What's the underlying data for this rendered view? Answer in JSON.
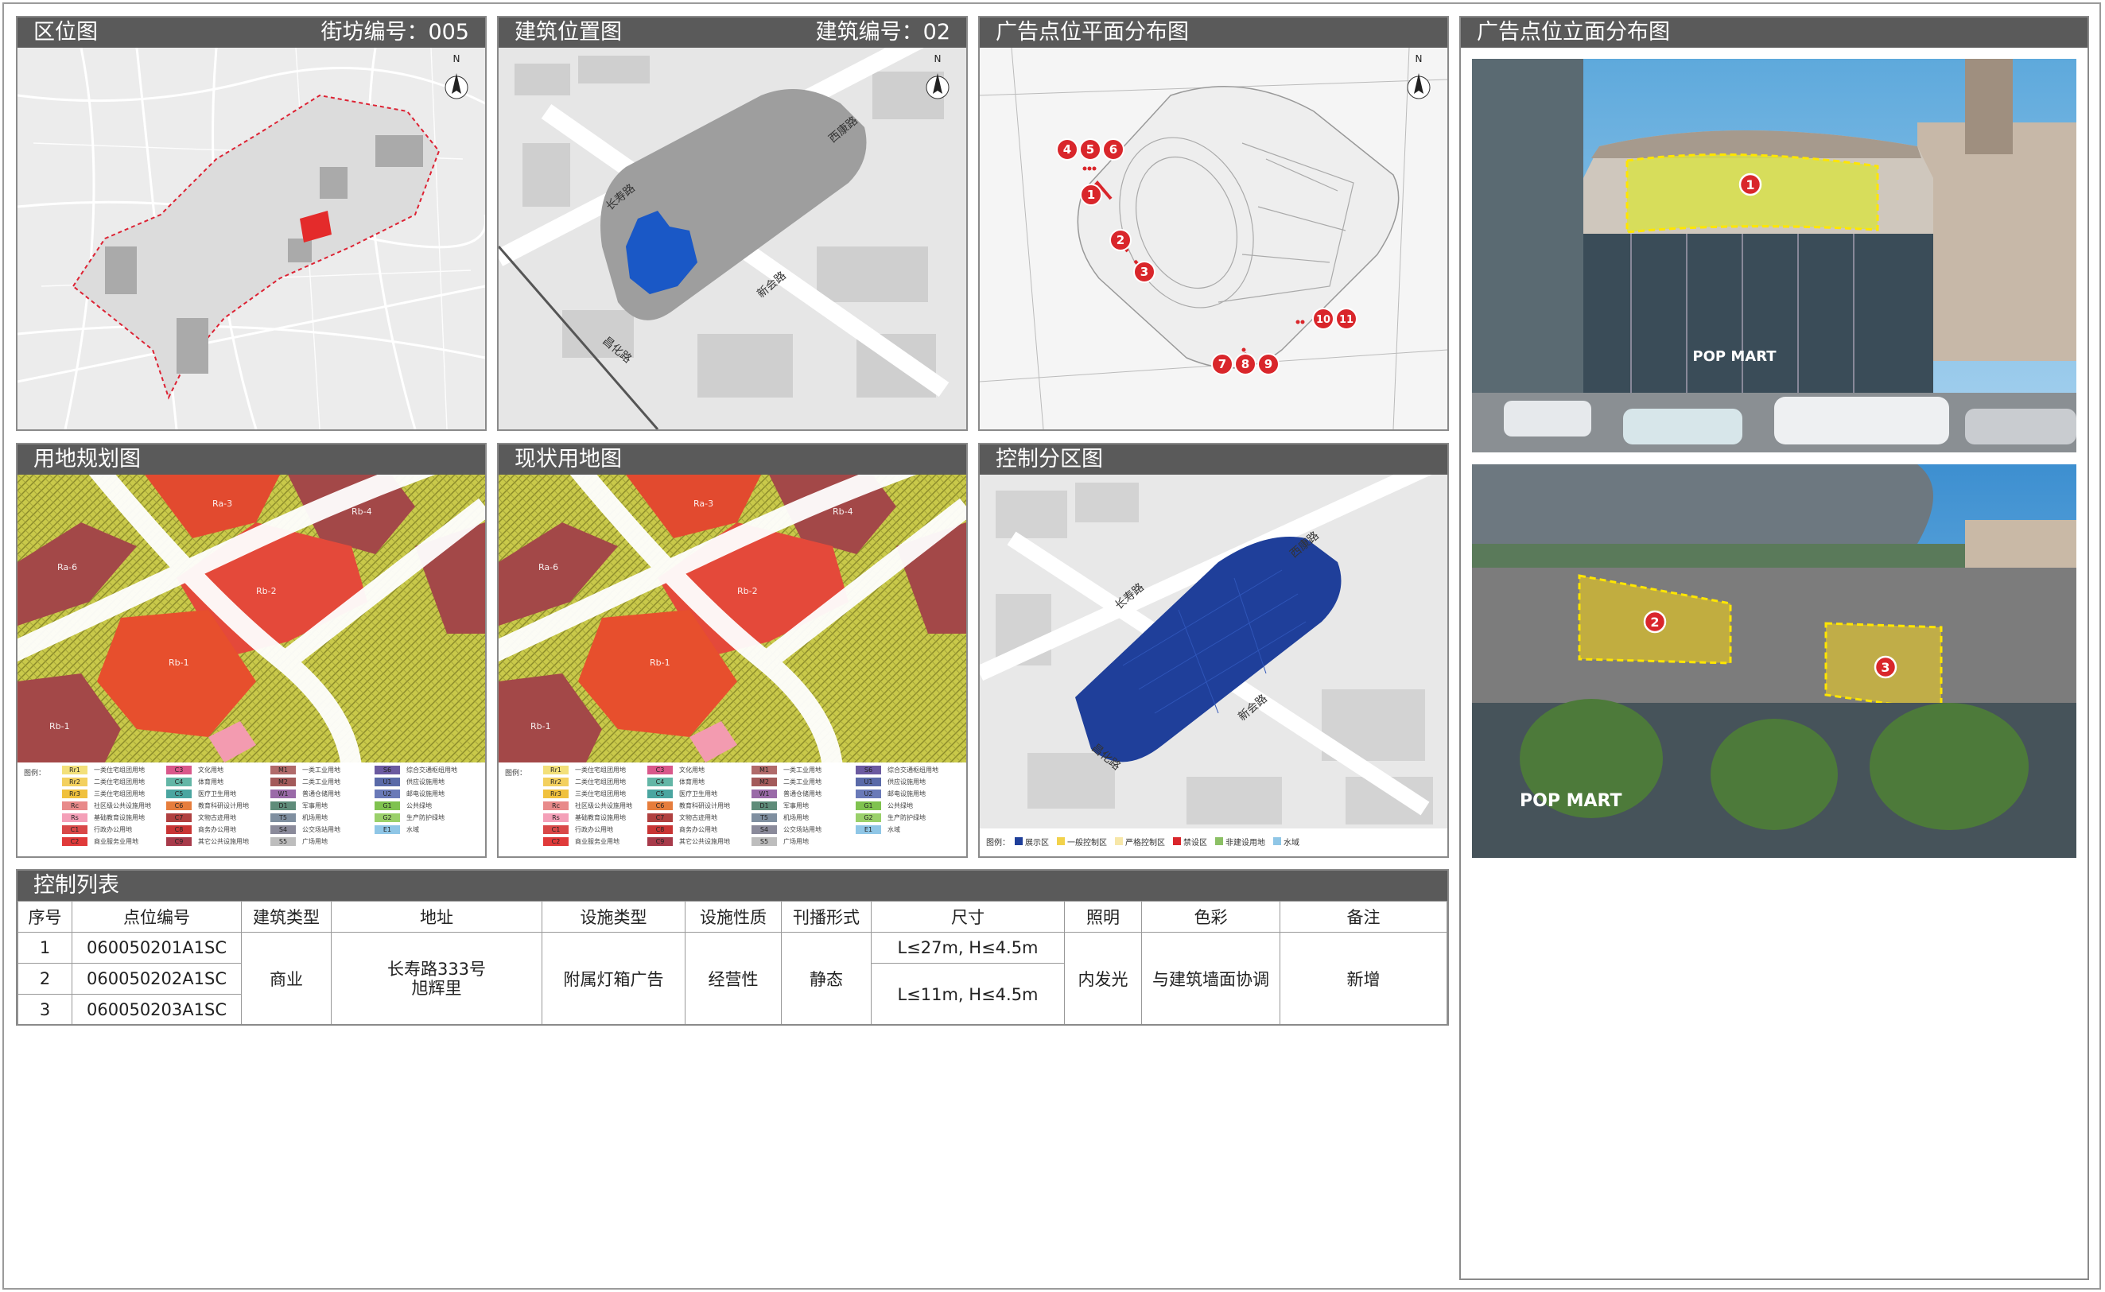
{
  "panels": {
    "location": {
      "title": "区位图",
      "sub": "街坊编号：005"
    },
    "building": {
      "title": "建筑位置图",
      "sub": "建筑编号：02",
      "roads": [
        "长寿路",
        "新会路",
        "昌化路",
        "西康路"
      ]
    },
    "plan": {
      "title": "广告点位平面分布图",
      "markers": [
        "1",
        "2",
        "3",
        "4",
        "5",
        "6",
        "7",
        "8",
        "9",
        "10",
        "11"
      ]
    },
    "elevation": {
      "title": "广告点位立面分布图",
      "markers": [
        "1",
        "2",
        "3"
      ],
      "sign_text": "POP MART"
    },
    "landuse_plan": {
      "title": "用地规划图",
      "legend_prefix": "图例："
    },
    "landuse_now": {
      "title": "现状用地图",
      "legend_prefix": "图例："
    },
    "control": {
      "title": "控制分区图",
      "roads": [
        "长寿路",
        "新会路",
        "昌化路",
        "西康路"
      ],
      "legend_prefix": "图例：",
      "legend": [
        {
          "label": "展示区",
          "color": "#1f3f9a"
        },
        {
          "label": "一般控制区",
          "color": "#f2d24b"
        },
        {
          "label": "严格控制区",
          "color": "#f7e7a8"
        },
        {
          "label": "禁设区",
          "color": "#d9262b"
        },
        {
          "label": "非建设用地",
          "color": "#8cc065"
        },
        {
          "label": "水域",
          "color": "#8fc6e6"
        }
      ]
    }
  },
  "north": "N",
  "legend_items": [
    {
      "code": "Rr1",
      "name": "一类住宅组团用地",
      "color": "#f3e07a"
    },
    {
      "code": "Rr2",
      "name": "二类住宅组团用地",
      "color": "#f3d05e"
    },
    {
      "code": "Rr3",
      "name": "三类住宅组团用地",
      "color": "#f0c13e"
    },
    {
      "code": "Rc",
      "name": "社区级公共设施用地",
      "color": "#e88a8a"
    },
    {
      "code": "Rs",
      "name": "基础教育设施用地",
      "color": "#f4a0b8"
    },
    {
      "code": "C1",
      "name": "行政办公用地",
      "color": "#d94848"
    },
    {
      "code": "C2",
      "name": "商业服务业用地",
      "color": "#e03a3a"
    },
    {
      "code": "C3",
      "name": "文化用地",
      "color": "#d9588a"
    },
    {
      "code": "C4",
      "name": "体育用地",
      "color": "#63b6a6"
    },
    {
      "code": "C5",
      "name": "医疗卫生用地",
      "color": "#4aa5a0"
    },
    {
      "code": "C6",
      "name": "教育科研设计用地",
      "color": "#e67d3c"
    },
    {
      "code": "C7",
      "name": "文物古迹用地",
      "color": "#b04040"
    },
    {
      "code": "C8",
      "name": "商务办公用地",
      "color": "#c83434"
    },
    {
      "code": "C9",
      "name": "其它公共设施用地",
      "color": "#a73a4a"
    },
    {
      "code": "M1",
      "name": "一类工业用地",
      "color": "#b06a6a"
    },
    {
      "code": "M2",
      "name": "二类工业用地",
      "color": "#a35a5a"
    },
    {
      "code": "W1",
      "name": "普通仓储用地",
      "color": "#9a6aa8"
    },
    {
      "code": "D1",
      "name": "军事用地",
      "color": "#5f8c7a"
    },
    {
      "code": "T5",
      "name": "机场用地",
      "color": "#7f8fa0"
    },
    {
      "code": "S4",
      "name": "公交场站用地",
      "color": "#8a8a9a"
    },
    {
      "code": "S5",
      "name": "广场用地",
      "color": "#bdbdbd"
    },
    {
      "code": "S6",
      "name": "综合交通枢纽用地",
      "color": "#6b5aa0"
    },
    {
      "code": "U1",
      "name": "供应设施用地",
      "color": "#5a6aa8"
    },
    {
      "code": "U2",
      "name": "邮电设施用地",
      "color": "#6a7ab8"
    },
    {
      "code": "G1",
      "name": "公共绿地",
      "color": "#7fc24f"
    },
    {
      "code": "G2",
      "name": "生产防护绿地",
      "color": "#9ad06a"
    },
    {
      "code": "E1",
      "name": "水域",
      "color": "#8fc6e6"
    }
  ],
  "table": {
    "title": "控制列表",
    "headers": [
      "序号",
      "点位编号",
      "建筑类型",
      "地址",
      "设施类型",
      "设施性质",
      "刊播形式",
      "尺寸",
      "照明",
      "色彩",
      "备注"
    ],
    "rows": [
      {
        "no": "1",
        "code": "060050201A1SC"
      },
      {
        "no": "2",
        "code": "060050202A1SC"
      },
      {
        "no": "3",
        "code": "060050203A1SC"
      }
    ],
    "building_type": "商业",
    "address_line1": "长寿路333号",
    "address_line2": "旭辉里",
    "facility_type": "附属灯箱广告",
    "facility_nature": "经营性",
    "broadcast": "静态",
    "size1": "L≤27m, H≤4.5m",
    "size2": "L≤11m, H≤4.5m",
    "lighting": "内发光",
    "color": "与建筑墙面协调",
    "remark": "新增"
  }
}
